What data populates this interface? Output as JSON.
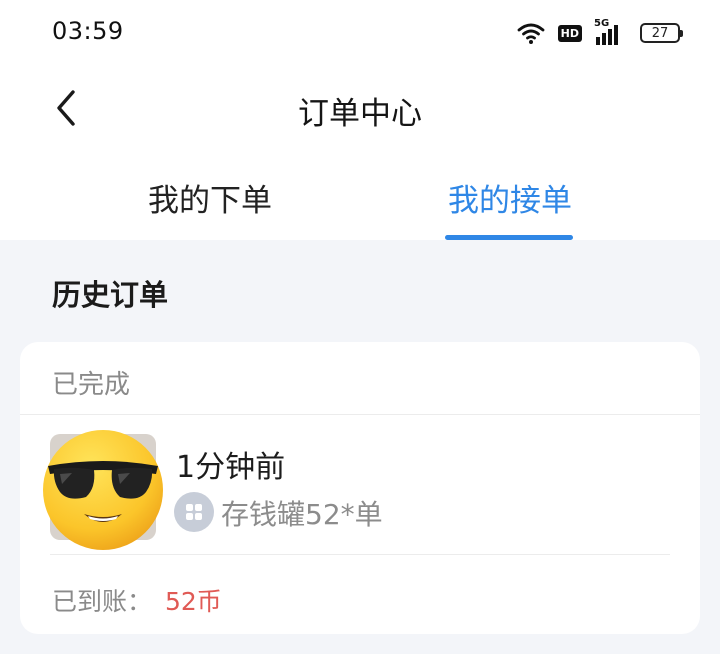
{
  "status_bar": {
    "time": "03:59",
    "hd_label": "HD",
    "network_label": "5G",
    "battery_level": "27",
    "icons": [
      "wifi-icon",
      "hd-icon",
      "signal-5g-icon",
      "battery-icon"
    ]
  },
  "header": {
    "title": "订单中心",
    "back_icon": "chevron-left-icon"
  },
  "tabs": [
    {
      "label": "我的下单",
      "active": false
    },
    {
      "label": "我的接单",
      "active": true
    }
  ],
  "accent_color": "#2f87e6",
  "section": {
    "title": "历史订单"
  },
  "order": {
    "status": "已完成",
    "time": "1分钟前",
    "name": "存钱罐52*单",
    "product_icon": "piggy-bank-icon",
    "avatar_icon": "cool-sunglasses-emoji",
    "arrived_label": "已到账：",
    "arrived_amount": "52币",
    "amount_color": "#e05a55"
  }
}
